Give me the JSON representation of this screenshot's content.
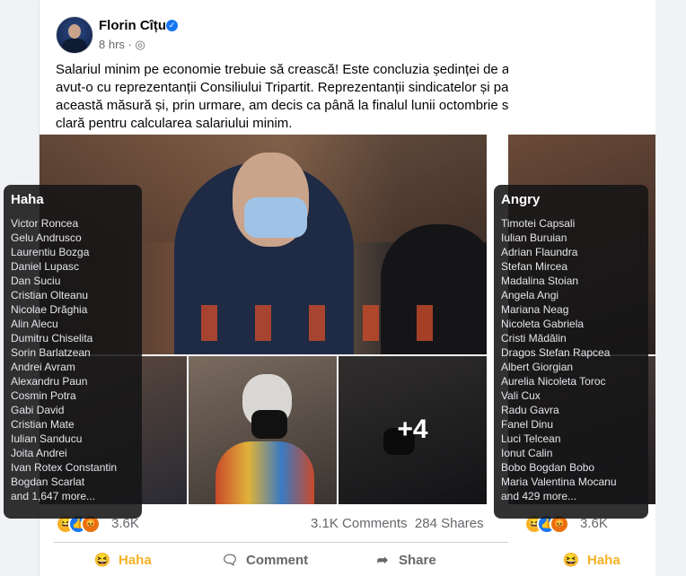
{
  "post": {
    "author": "Florin Cîțu",
    "time": "8 hrs",
    "privacy_icon": "globe-icon",
    "text": "Salariul minim pe economie trebuie să crească! Este concluzia ședinței de astăzi pe care am avut-o cu reprezentanții Consiliului Tripartit. Reprezentanții sindicatelor și patronatelor susțin această măsură și, prin urmare, am decis ca până la finalul lunii octombrie să avem o formulă clară pentru calcularea salariului minim.",
    "more_photos": "+4",
    "reaction_count": "3.6K",
    "comments": "3.1K Comments",
    "shares": "284 Shares",
    "actions": {
      "haha": "Haha",
      "comment": "Comment",
      "share": "Share"
    },
    "colors": {
      "haha": "#f7b125",
      "like": "#1877f2",
      "angry": "#e9710f"
    }
  },
  "post2": {
    "reaction_count": "3.6K",
    "haha": "Haha"
  },
  "tooltip_haha": {
    "title": "Haha",
    "names": [
      "Victor Roncea",
      "Gelu Andrusco",
      "Laurentiu Bozga",
      "Daniel Lupasc",
      "Dan Suciu",
      "Cristian Olteanu",
      "Nicolae Drăghia",
      "Alin Alecu",
      "Dumitru Chiselita",
      "Sorin Barlatzean",
      "Andrei Avram",
      "Alexandru Paun",
      "Cosmin Potra",
      "Gabi David",
      "Cristian Mate",
      "Iulian Sanducu",
      "Joita Andrei",
      "Ivan Rotex Constantin",
      "Bogdan Scarlat",
      "and 1,647 more..."
    ]
  },
  "tooltip_angry": {
    "title": "Angry",
    "names": [
      "Timotei Capsali",
      "Iulian Buruian",
      "Adrian Flaundra",
      "Stefan Mircea",
      "Madalina Stoian",
      "Angela Angi",
      "Mariana Neag",
      "Nicoleta Gabriela",
      "Cristi Mădălin",
      "Dragos Stefan Rapcea",
      "Albert Giorgian",
      "Aurelia Nicoleta Toroc",
      "Vali Cux",
      "Radu Gavra",
      "Fanel Dinu",
      "Luci Telcean",
      "Ionut Calin",
      "Bobo Bogdan Bobo",
      "Maria Valentina Mocanu",
      "and 429 more..."
    ]
  }
}
